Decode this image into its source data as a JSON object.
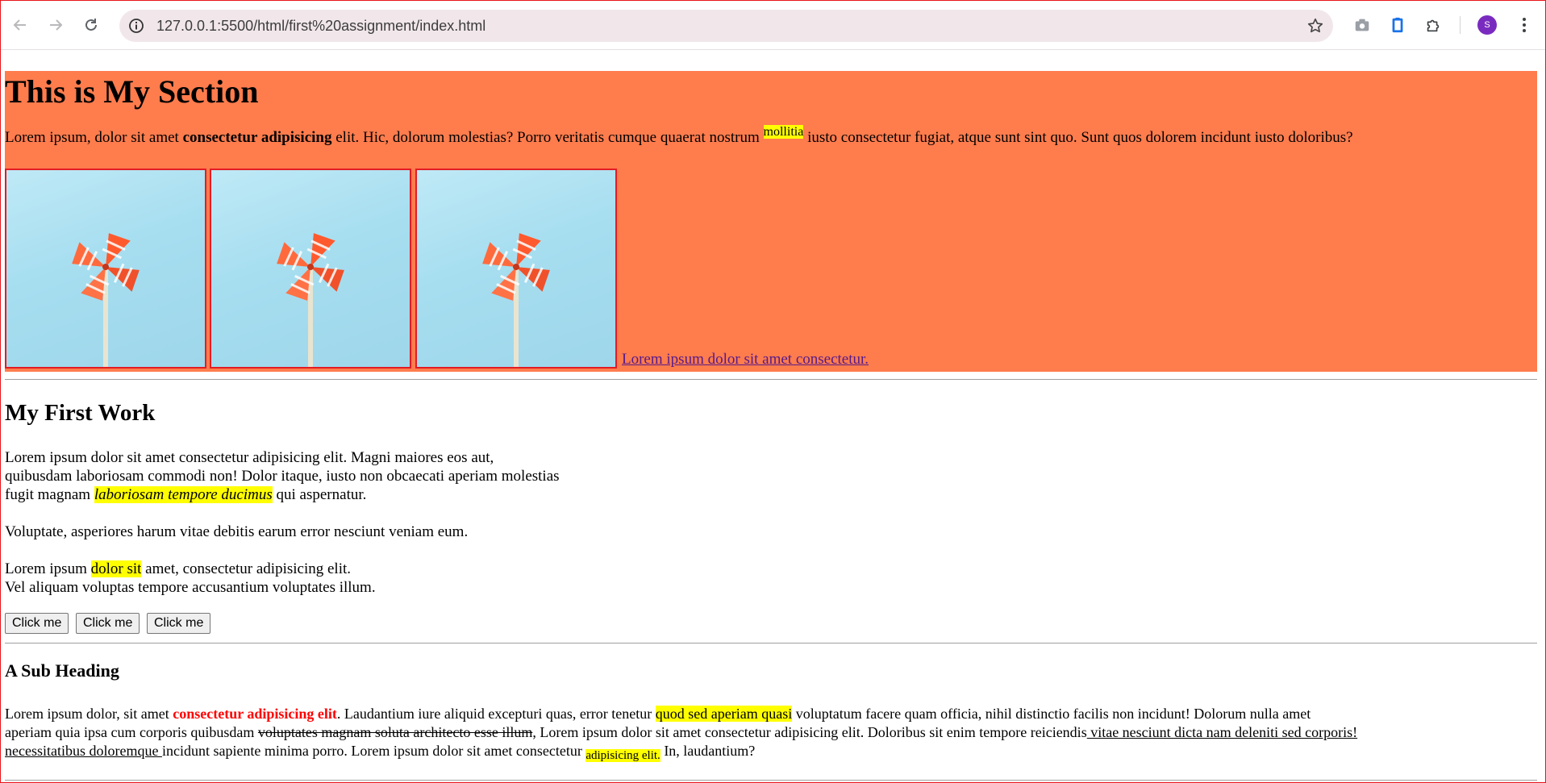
{
  "browser": {
    "url": "127.0.0.1:5500/html/first%20assignment/index.html",
    "avatar_letter": "S",
    "icons": {
      "back": "back-arrow-icon",
      "forward": "forward-arrow-icon",
      "reload": "reload-icon",
      "info": "info-icon",
      "bookmark": "star-icon",
      "camera": "camera-icon",
      "clipboard": "clipboard-icon",
      "extensions": "puzzle-icon",
      "menu": "kebab-menu-icon"
    }
  },
  "section": {
    "title": "This is My Section",
    "background": "#ff7c4d",
    "intro": {
      "t1": "Lorem ipsum, dolor sit amet ",
      "b1": "consectetur adipisicing",
      "t2": " elit. Hic, dolorum molestias? Porro veritatis cumque quaerat nostrum ",
      "mark": "mollitia",
      "t3": " iusto consectetur fugiat, atque sunt sint quo. Sunt quos dolorem incidunt iusto doloribus?"
    },
    "image_border_color": "#e31c23",
    "link_text": "Lorem ipsum dolor sit amet consectetur."
  },
  "first_work": {
    "heading": "My First Work",
    "p1": {
      "l1": "Lorem ipsum dolor sit amet consectetur adipisicing elit. Magni maiores eos aut,",
      "l2": "quibusdam laboriosam commodi non! Dolor itaque, iusto non obcaecati aperiam molestias",
      "l3a": "fugit magnam ",
      "l3_mark": "laboriosam tempore ducimus",
      "l3b": " qui aspernatur."
    },
    "p2": "Voluptate, asperiores harum vitae debitis earum error nesciunt veniam eum.",
    "p3": {
      "a": "Lorem ipsum ",
      "mark": "dolor sit",
      "b": " amet, consectetur adipisicing elit.",
      "l2": "Vel aliquam voluptas tempore accusantium voluptates illum."
    },
    "buttons": [
      "Click me",
      "Click me",
      "Click me"
    ]
  },
  "sub": {
    "heading": "A Sub Heading",
    "p": {
      "t1": "Lorem ipsum dolor, sit amet ",
      "red": "consectetur adipisicing elit",
      "t2": ". Laudantium iure aliquid excepturi quas, error tenetur ",
      "mark1": "quod sed aperiam quasi",
      "t3": " voluptatum facere quam officia, nihil distinctio facilis non incidunt! Dolorum nulla amet",
      "t4": "aperiam quia ipsa cum corporis quibusdam ",
      "strike": "voluptates magnam soluta architecto esse illum",
      "t5": ", Lorem ipsum dolor sit amet consectetur adipisicing elit. Doloribus sit enim tempore reiciendis",
      "u1": " vitae nesciunt dicta nam deleniti sed corporis!",
      "u2": "necessitatibus doloremque ",
      "t6": "incidunt sapiente minima porro. Lorem ipsum dolor sit amet consectetur ",
      "mark2": "adipisicing elit.",
      "t7": " In, laudantium?"
    }
  },
  "colors": {
    "highlight": "#ffff00",
    "red_text": "#ff0000",
    "link_visited": "#551a8b"
  }
}
